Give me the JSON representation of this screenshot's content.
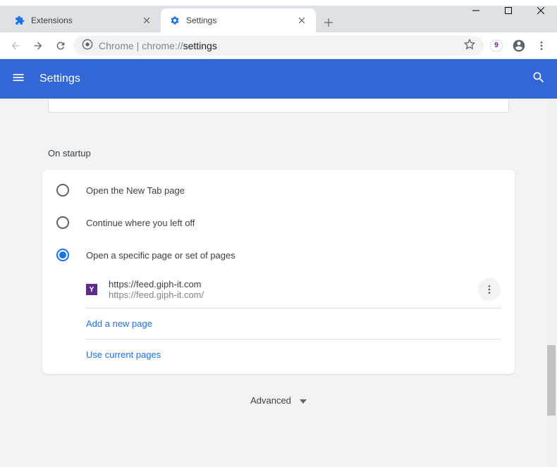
{
  "window": {
    "tabs": [
      {
        "title": "Extensions",
        "active": false
      },
      {
        "title": "Settings",
        "active": true
      }
    ]
  },
  "addressbar": {
    "prefix": "Chrome",
    "separator": " | ",
    "url_gray": "chrome://",
    "url_dark": "settings"
  },
  "header": {
    "title": "Settings"
  },
  "startup": {
    "section_label": "On startup",
    "options": [
      {
        "label": "Open the New Tab page",
        "checked": false
      },
      {
        "label": "Continue where you left off",
        "checked": false
      },
      {
        "label": "Open a specific page or set of pages",
        "checked": true
      }
    ],
    "pages": [
      {
        "favicon_letter": "Y",
        "title": "https://feed.giph-it.com",
        "url": "https://feed.giph-it.com/"
      }
    ],
    "add_page": "Add a new page",
    "use_current": "Use current pages"
  },
  "advanced_label": "Advanced"
}
